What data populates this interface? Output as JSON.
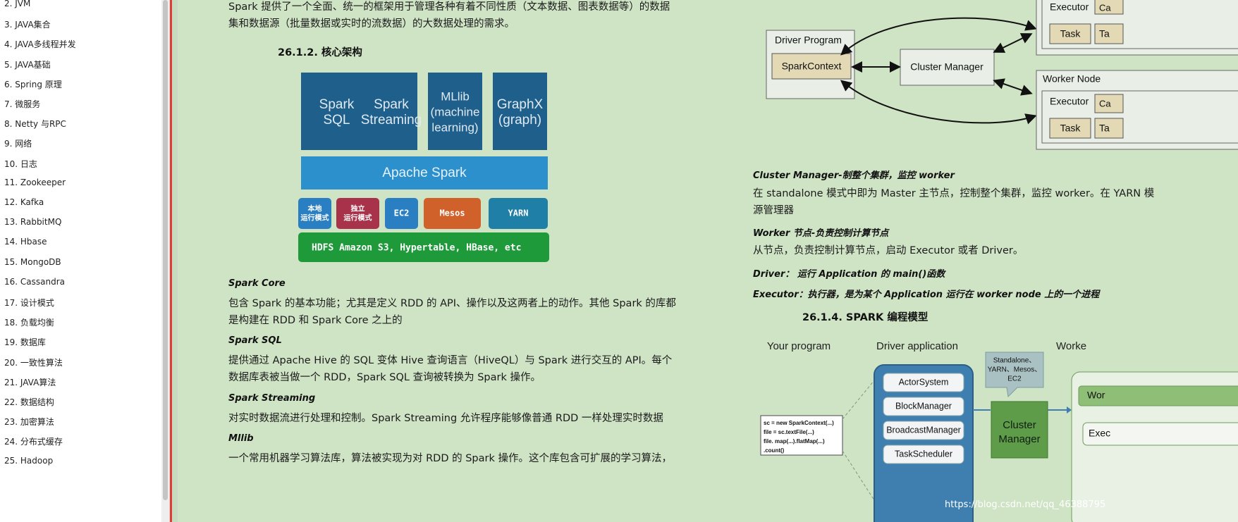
{
  "sidebar": {
    "items": [
      "2. JVM",
      "3. JAVA集合",
      "4. JAVA多线程并发",
      "5. JAVA基础",
      "6. Spring 原理",
      "7.    微服务",
      "8. Netty 与RPC",
      "9. 网络",
      "10. 日志",
      "11. Zookeeper",
      "12. Kafka",
      "13. RabbitMQ",
      "14. Hbase",
      "15. MongoDB",
      "16. Cassandra",
      "17. 设计模式",
      "18. 负载均衡",
      "19. 数据库",
      "20. 一致性算法",
      "21. JAVA算法",
      "22. 数据结构",
      "23. 加密算法",
      "24. 分布式缓存",
      "25. Hadoop"
    ]
  },
  "left": {
    "intro1": "Spark 提供了一个全面、统一的框架用于管理各种有着不同性质（文本数据、图表数据等）的数据",
    "intro2": "集和数据源（批量数据或实时的流数据）的大数据处理的需求。",
    "heading": "26.1.2.    核心架构",
    "core_title": "Spark Core",
    "core1": "包含 Spark 的基本功能；尤其是定义 RDD 的 API、操作以及这两者上的动作。其他 Spark 的库都",
    "core2": "是构建在 RDD 和 Spark Core 之上的",
    "sql_title": "Spark SQL",
    "sql1": "提供通过 Apache Hive 的 SQL 变体 Hive 查询语言（HiveQL）与 Spark 进行交互的 API。每个",
    "sql2": "数据库表被当做一个 RDD，Spark SQL 查询被转换为 Spark 操作。",
    "stream_title": "Spark Streaming",
    "stream1": "对实时数据流进行处理和控制。Spark Streaming 允许程序能够像普通 RDD 一样处理实时数据",
    "mllib_title": "Mllib",
    "mllib1": "一个常用机器学习算法库，算法被实现为对 RDD 的 Spark 操作。这个库包含可扩展的学习算法，"
  },
  "arch": {
    "top": [
      "Spark\nSQL",
      "Spark\nStreaming",
      "MLlib\n(machine\nlearning)",
      "GraphX\n(graph)"
    ],
    "core": "Apache Spark",
    "sched": [
      "本地\n运行模式",
      "独立\n运行模式",
      "EC2",
      "Mesos",
      "YARN"
    ],
    "storage": "HDFS     Amazon S3, Hypertable, HBase, etc"
  },
  "cluster": {
    "driver": "Driver Program",
    "ctx": "SparkContext",
    "cm": "Cluster Manager",
    "worker": "Worker Node",
    "executor": "Executor",
    "task": "Task",
    "cache": "Ca",
    "ta": "Ta"
  },
  "right": {
    "cm_title": "Cluster Manager-制整个集群，监控 worker",
    "cm1": "在 standalone 模式中即为 Master 主节点，控制整个集群，监控 worker。在 YARN 模",
    "cm2": "源管理器",
    "worker_title": "Worker 节点-负责控制计算节点",
    "worker1": "从节点，负责控制计算节点，启动 Executor 或者 Driver。",
    "driver_line": "Driver： 运行 Application 的 main()函数",
    "exec_line": "Executor：执行器，是为某个 Application 运行在 worker node 上的一个进程",
    "heading": "26.1.4.    SPARK 编程模型"
  },
  "model": {
    "cols": [
      "Your program",
      "Driver application",
      "Worke"
    ],
    "code": [
      "sc = new SparkContext(...)",
      "file = sc.textFile(...)",
      "file. map(...).flatMap(...)",
      ".count()"
    ],
    "driver_items": [
      "ActorSystem",
      "BlockManager",
      "BroadcastManager",
      "TaskScheduler"
    ],
    "note": "Standalone、\nYARN、Mesos、\nEC2",
    "cm": "Cluster\nManager",
    "worker_items": [
      "Wor",
      "Exec"
    ]
  },
  "watermark": "https://blog.csdn.net/qq_46388795"
}
